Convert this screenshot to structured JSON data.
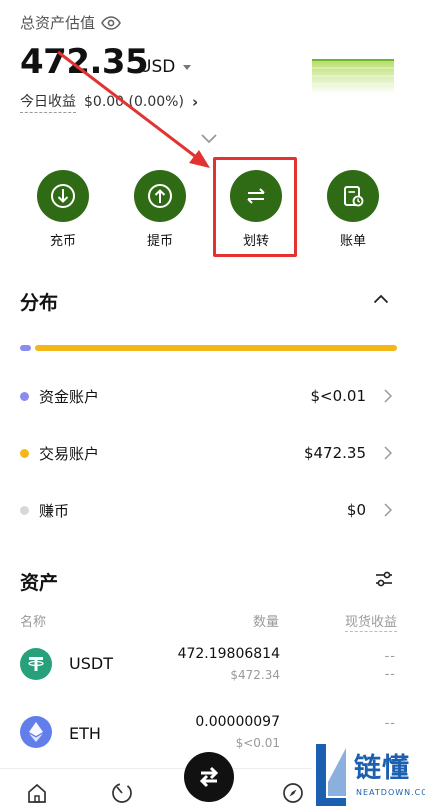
{
  "header": {
    "total_label": "总资产估值",
    "total_value": "472.35",
    "currency": "USD",
    "today_label": "今日收益",
    "today_value": "$0.00 (0.00%)"
  },
  "actions": [
    {
      "label": "充币",
      "icon": "deposit-icon"
    },
    {
      "label": "提币",
      "icon": "withdraw-icon"
    },
    {
      "label": "划转",
      "icon": "transfer-icon"
    },
    {
      "label": "账单",
      "icon": "bill-icon"
    }
  ],
  "distribution": {
    "title": "分布",
    "funding_share": 0.0,
    "trading_share": 1.0,
    "accounts": [
      {
        "name": "资金账户",
        "value": "$<0.01",
        "color": "#8a8cf0"
      },
      {
        "name": "交易账户",
        "value": "$472.35",
        "color": "#f2b81a"
      },
      {
        "name": "赚币",
        "value": "$0",
        "color": "#d8d8d8"
      }
    ]
  },
  "assets": {
    "title": "资产",
    "columns": {
      "name": "名称",
      "quantity": "数量",
      "pnl": "现货收益"
    },
    "rows": [
      {
        "coin": "USDT",
        "quantity": "472.19806814",
        "value": "$472.34",
        "pnl": "--\n--",
        "color": "#26a17b"
      },
      {
        "coin": "ETH",
        "quantity": "0.00000097",
        "value": "$<0.01",
        "pnl": "--",
        "color": "#627eea"
      }
    ]
  },
  "watermark": {
    "text": "链懂",
    "sub": "NEATDOWN.COM"
  },
  "colors": {
    "accent_green": "#2e6b14",
    "highlight_red": "#e23232"
  }
}
